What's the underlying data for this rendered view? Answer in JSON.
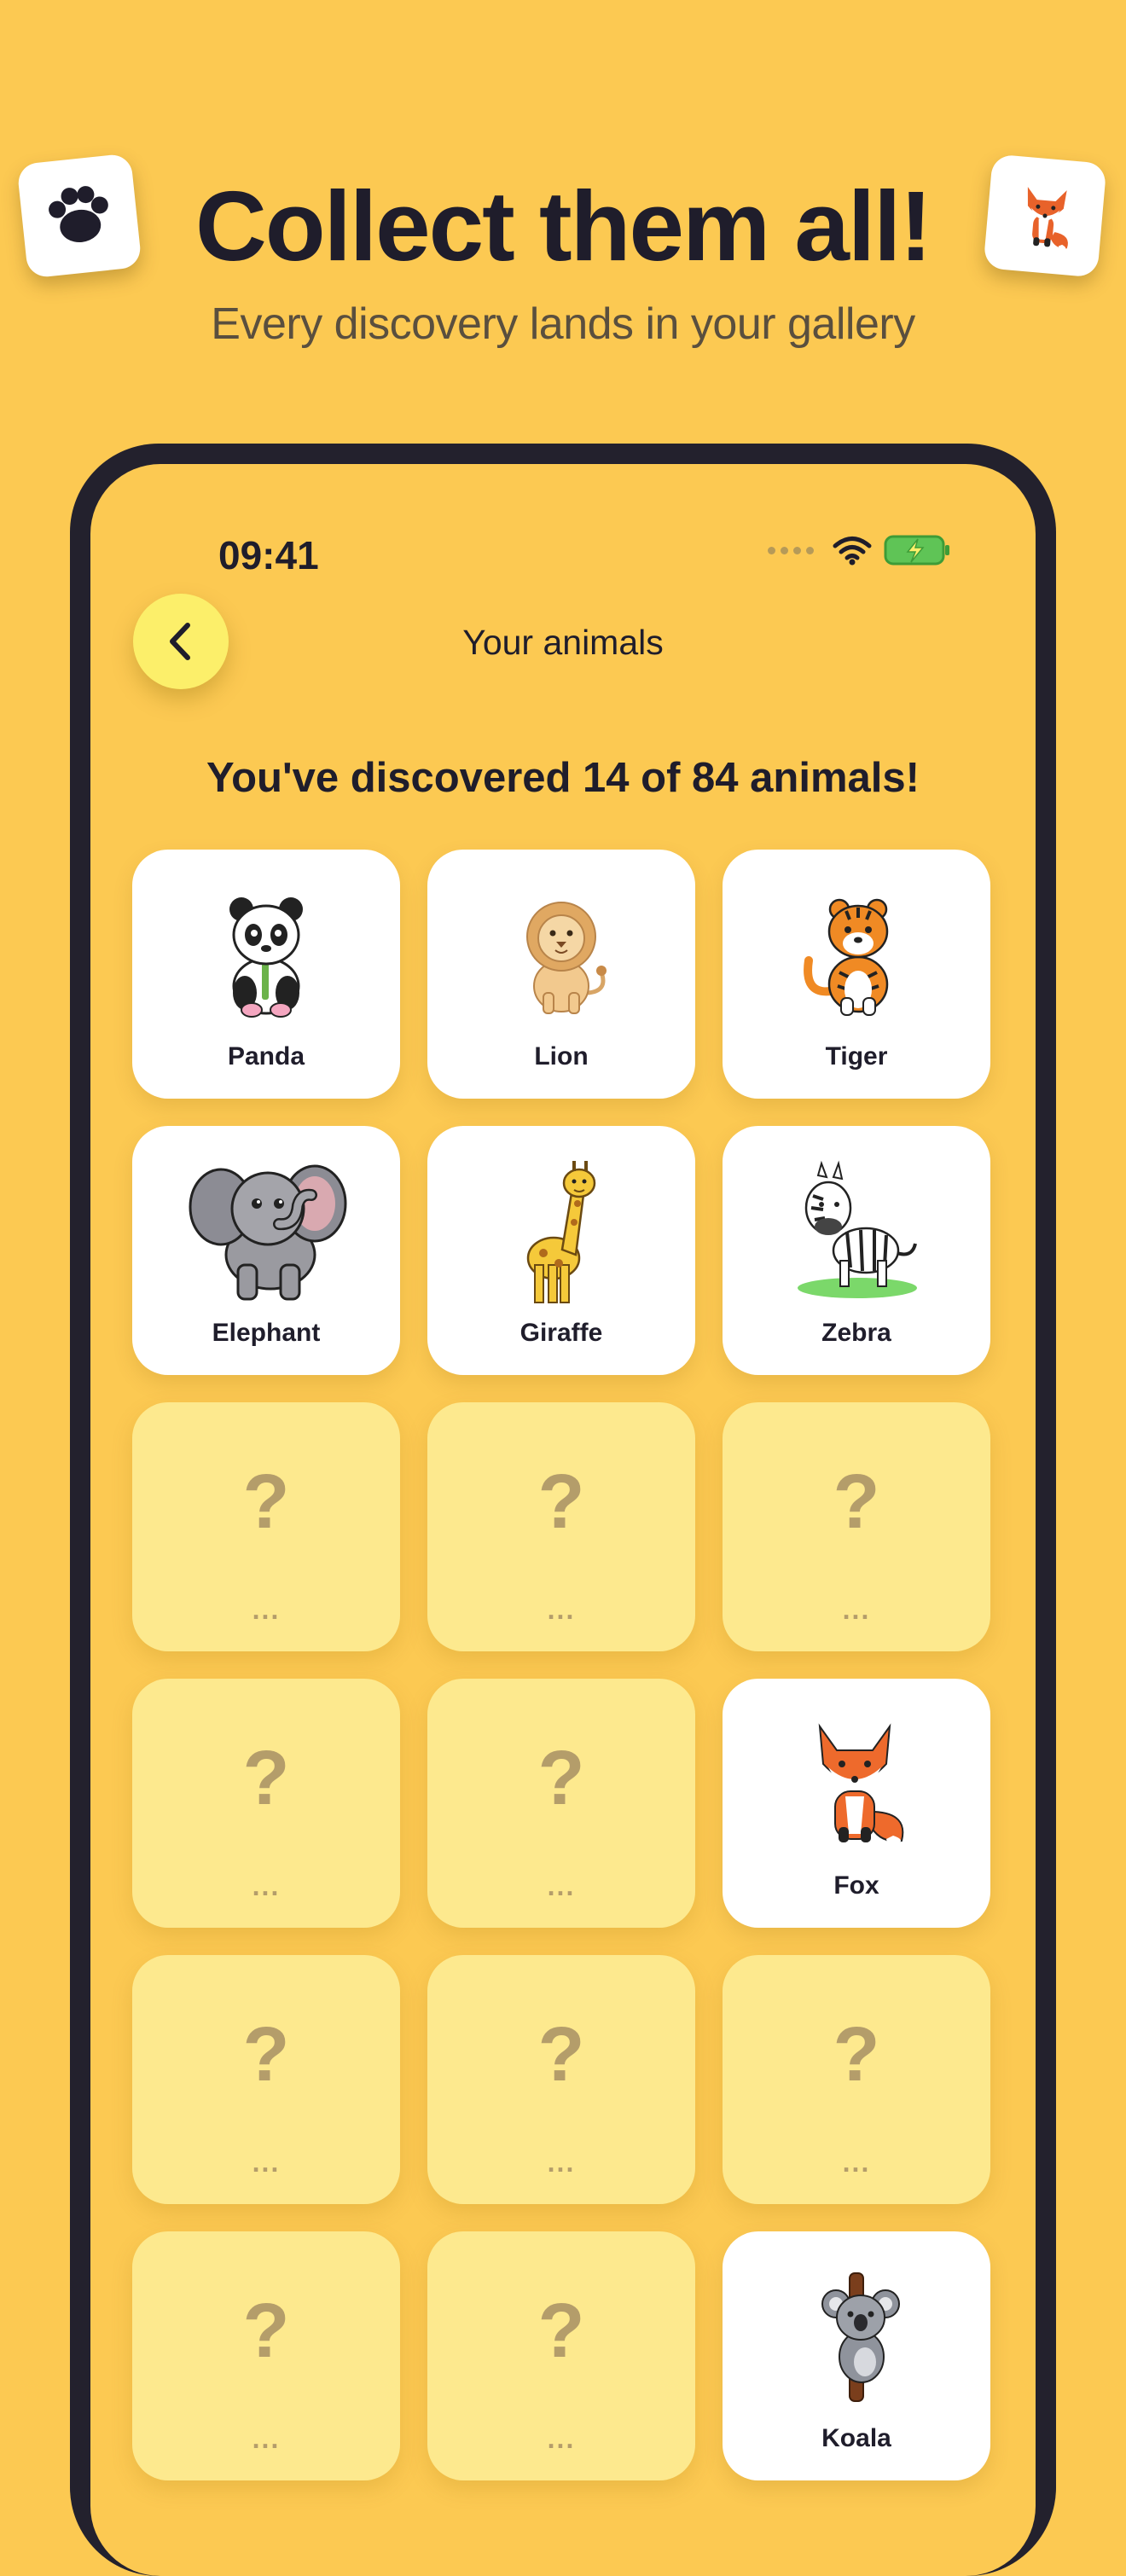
{
  "hero": {
    "title": "Collect them all!",
    "subtitle": "Every discovery lands in your gallery"
  },
  "icons": {
    "left_sticker": "paw-icon",
    "right_sticker": "fox-icon",
    "back": "chevron-left-icon",
    "wifi": "wifi-icon",
    "battery": "battery-charging-icon"
  },
  "status_bar": {
    "time": "09:41"
  },
  "nav": {
    "title": "Your animals"
  },
  "summary": {
    "text": "You've discovered 14 of 84 animals!"
  },
  "colors": {
    "background": "#fcc952",
    "phone_frame": "#23212d",
    "back_button": "#fcef6a",
    "card_found": "#ffffff",
    "card_locked": "#fde98e",
    "locked_glyph": "#b49d6a",
    "battery": "#5fc456"
  },
  "locked_card": {
    "mark": "?",
    "ellipsis": "..."
  },
  "gallery": [
    {
      "name": "Panda",
      "found": true
    },
    {
      "name": "Lion",
      "found": true
    },
    {
      "name": "Tiger",
      "found": true
    },
    {
      "name": "Elephant",
      "found": true
    },
    {
      "name": "Giraffe",
      "found": true
    },
    {
      "name": "Zebra",
      "found": true
    },
    {
      "name": "",
      "found": false
    },
    {
      "name": "",
      "found": false
    },
    {
      "name": "",
      "found": false
    },
    {
      "name": "",
      "found": false
    },
    {
      "name": "",
      "found": false
    },
    {
      "name": "Fox",
      "found": true
    },
    {
      "name": "",
      "found": false
    },
    {
      "name": "",
      "found": false
    },
    {
      "name": "",
      "found": false
    },
    {
      "name": "",
      "found": false
    },
    {
      "name": "",
      "found": false
    },
    {
      "name": "Koala",
      "found": true
    }
  ]
}
